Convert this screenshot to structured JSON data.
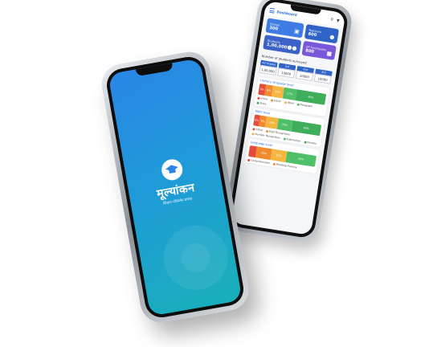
{
  "dashboard": {
    "appbar_title": "Dashboard",
    "search_icon": "search-icon",
    "filter_icon": "filter-icon",
    "cards": [
      {
        "title": "School",
        "value": "300",
        "icon": "school-icon",
        "color": "#3e7be2"
      },
      {
        "title": "Teachers",
        "value": "600",
        "icon": "teacher-icon",
        "color": "#2f63c6"
      },
      {
        "title": "Students",
        "value": "1,00,000",
        "icon": "students-icon",
        "color": "#3b63c7"
      },
      {
        "title": "ZP Employees",
        "value": "800",
        "icon": "employee-icon",
        "color": "#7a56d9"
      }
    ],
    "surveyed_title": "Number of students surveyed",
    "grades": [
      {
        "label": "All Grades",
        "value": "1,00,000"
      },
      {
        "label": "1st",
        "value": "10000"
      },
      {
        "label": "2nd",
        "value": "10000"
      },
      {
        "label": "3rd",
        "value": "10000"
      }
    ],
    "panels": [
      {
        "title": "Literacy language level",
        "segments": [
          {
            "label": "9%",
            "pct": 9,
            "color": "#e84b3c"
          },
          {
            "label": "9%",
            "pct": 9,
            "color": "#f08a2e"
          },
          {
            "label": "15%",
            "pct": 15,
            "color": "#f4b63f"
          },
          {
            "label": "17%",
            "pct": 17,
            "color": "#4fbf6a"
          },
          {
            "label": "40%",
            "pct": 40,
            "color": "#3fae5b"
          }
        ],
        "legend": [
          "Initial",
          "Letter",
          "Word",
          "Paragraph",
          "Story"
        ]
      },
      {
        "title": "Math level",
        "segments": [
          {
            "label": "8%",
            "pct": 8,
            "color": "#e84b3c"
          },
          {
            "label": "9%",
            "pct": 9,
            "color": "#f08a2e"
          },
          {
            "label": "16%",
            "pct": 16,
            "color": "#f4b63f"
          },
          {
            "label": "20%",
            "pct": 20,
            "color": "#4fbf6a"
          },
          {
            "label": "40%",
            "pct": 40,
            "color": "#3fae5b"
          }
        ],
        "legend": [
          "Initial",
          "Digit Recognition",
          "Number Recognition",
          "Subtraction",
          "Division"
        ]
      },
      {
        "title": "Language level",
        "segments": [
          {
            "label": "",
            "pct": 10,
            "color": "#e84b3c"
          },
          {
            "label": "20%",
            "pct": 20,
            "color": "#f08a2e"
          },
          {
            "label": "20%",
            "pct": 20,
            "color": "#f4b63f"
          },
          {
            "label": "40%",
            "pct": 40,
            "color": "#4fbf6a"
          }
        ],
        "legend": [
          "Comprehension",
          "Reading Fluency"
        ]
      }
    ]
  },
  "splash": {
    "brand": "मूल्यांकन",
    "tagline": "शिक्षण-परिवर्तन-प्रभाव",
    "logo_icon": "graduation-cap-icon"
  }
}
